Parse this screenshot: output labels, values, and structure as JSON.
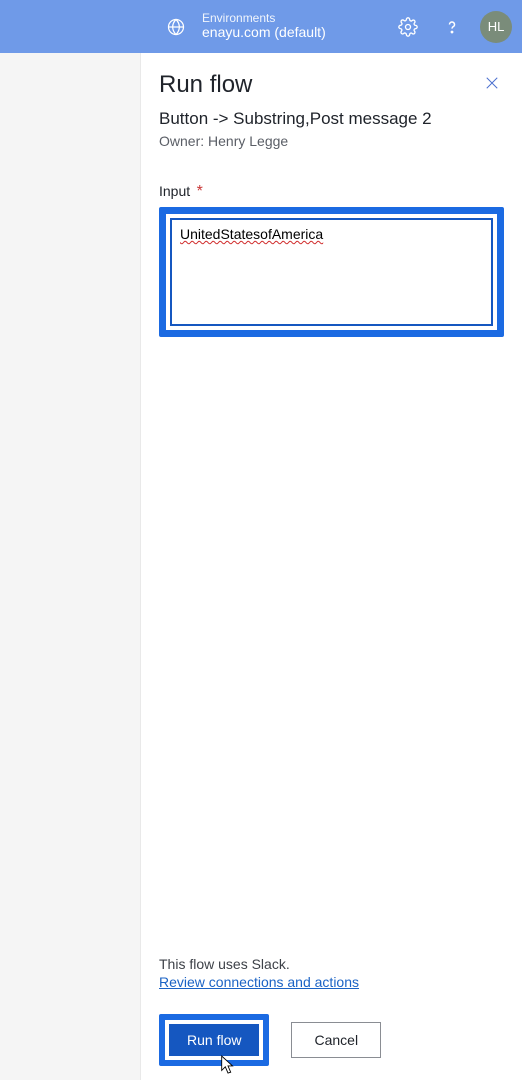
{
  "header": {
    "environments_label": "Environments",
    "environment_value": "enayu.com (default)",
    "avatar_initials": "HL"
  },
  "panel": {
    "title": "Run flow",
    "subtitle": "Button -> Substring,Post message 2",
    "owner_line": "Owner: Henry Legge",
    "input_label": "Input",
    "required_mark": "*",
    "input_value": "UnitedStatesofAmerica"
  },
  "footer": {
    "info_line": "This flow uses Slack.",
    "review_link": "Review connections and actions",
    "run_button": "Run flow",
    "cancel_button": "Cancel"
  }
}
